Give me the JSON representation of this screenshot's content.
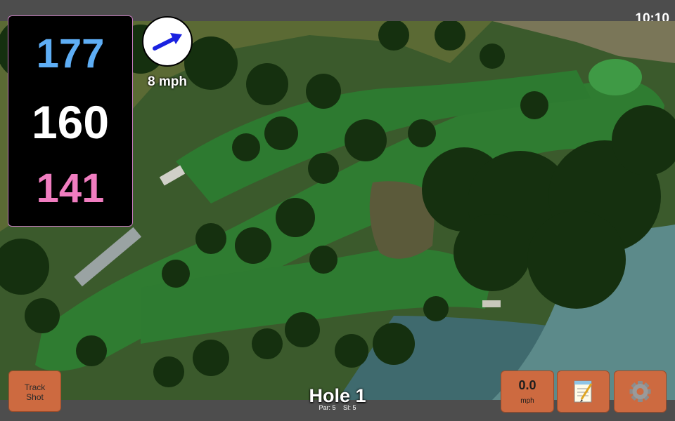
{
  "status_bar": {
    "time": "10:10"
  },
  "distances": {
    "back": "177",
    "middle": "160",
    "front": "141",
    "colors": {
      "back": "#5eaef5",
      "middle": "#ffffff",
      "front": "#f07dc0"
    }
  },
  "wind": {
    "speed": "8 mph",
    "icon": "wind-direction-arrow-icon",
    "arrow_color": "#1a22e0"
  },
  "buttons": {
    "track_shot": "Track\nShot",
    "speed_value": "0.0",
    "speed_unit": "mph",
    "notes_icon": "notepad-icon",
    "settings_icon": "gear-icon"
  },
  "hole": {
    "title": "Hole 1",
    "par": "Par: 5",
    "si": "SI: 5"
  },
  "colors": {
    "button": "#cd6a40",
    "panel_border": "#c77cc0"
  }
}
